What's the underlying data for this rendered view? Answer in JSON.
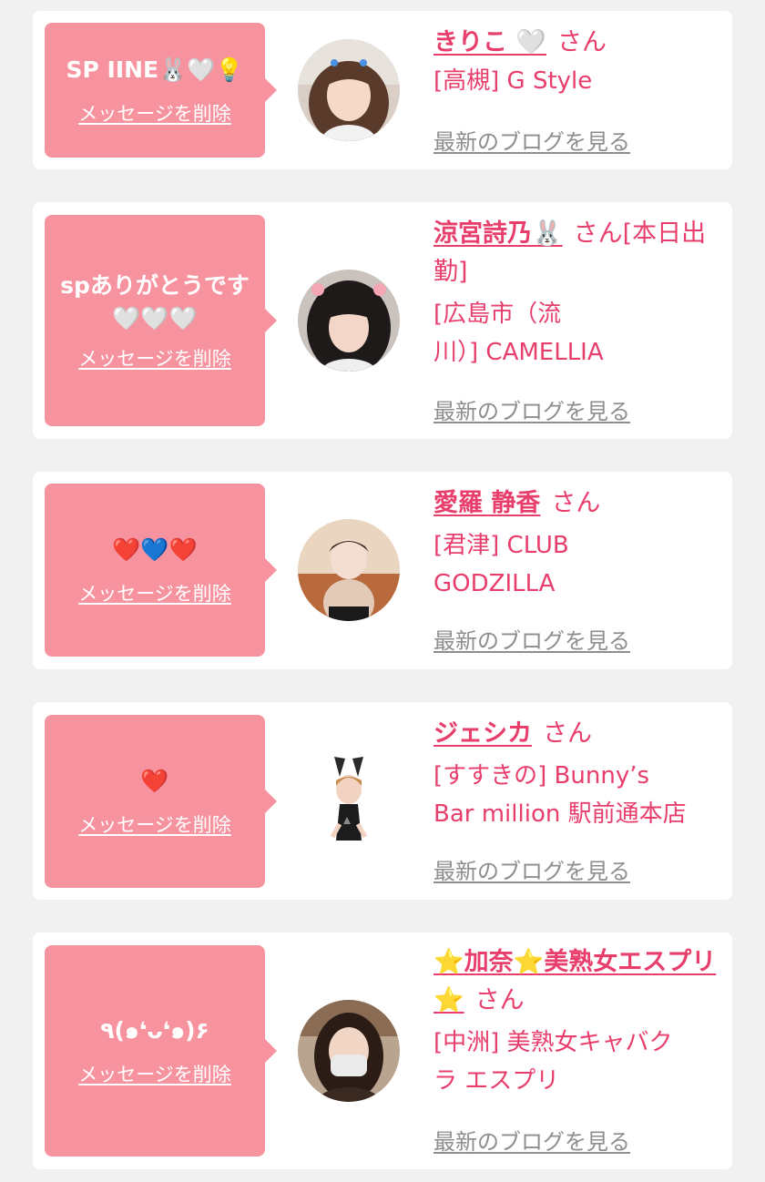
{
  "delete_label": "メッセージを削除",
  "blog_label": "最新のブログを見る",
  "san_label": "さん",
  "cards": [
    {
      "message": "SP IINE🐰🤍💡",
      "name": "きりこ 🤍",
      "shop_line1": "[高槻] G Style",
      "shop_line2": ""
    },
    {
      "message": "spありがとうです",
      "message_line2": "🤍🤍🤍",
      "name": "涼宮詩乃🐰",
      "name_suffix": "[本日出勤]",
      "shop_line1": "[広島市（流",
      "shop_line2": "川）] CAMELLIA"
    },
    {
      "message": "❤️💙❤️",
      "name": "愛羅 静香",
      "shop_line1": "[君津] CLUB",
      "shop_line2": "GODZILLA"
    },
    {
      "message": "❤️",
      "name": "ジェシカ",
      "shop_line1": "[すすきの] Bunny’s",
      "shop_line2": "Bar million 駅前通本店"
    },
    {
      "message": "٩(๑❛ᴗ❛๑)۶",
      "name": "⭐加奈⭐美熟女エスプリ⭐",
      "shop_line1": "[中洲] 美熟女キャバク",
      "shop_line2": "ラ エスプリ"
    }
  ],
  "colors": {
    "accent_pink": "#e83e6c",
    "bubble_pink": "#f7939f",
    "background": "#f1f1f1",
    "card": "#ffffff",
    "link_gray": "#8e8e8e"
  }
}
